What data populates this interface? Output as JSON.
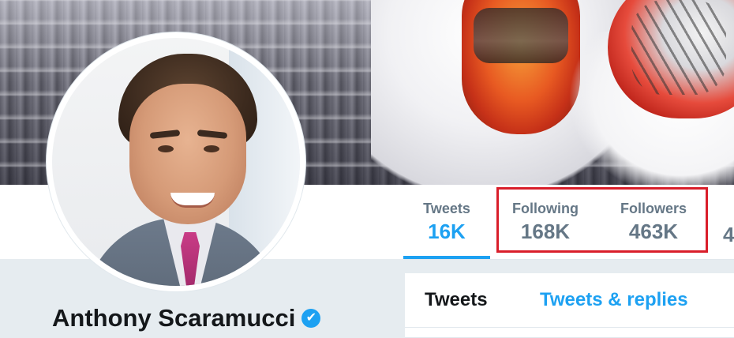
{
  "profile": {
    "name": "Anthony Scaramucci",
    "verified_icon": "✔"
  },
  "stats": {
    "tweets": {
      "label": "Tweets",
      "value": "16K"
    },
    "following": {
      "label": "Following",
      "value": "168K"
    },
    "followers": {
      "label": "Followers",
      "value": "463K"
    },
    "cut_off_value": "4"
  },
  "timeline_tabs": {
    "tweets": "Tweets",
    "tweets_replies": "Tweets & replies"
  },
  "colors": {
    "accent": "#1da1f2",
    "highlight": "#d91e2a"
  }
}
